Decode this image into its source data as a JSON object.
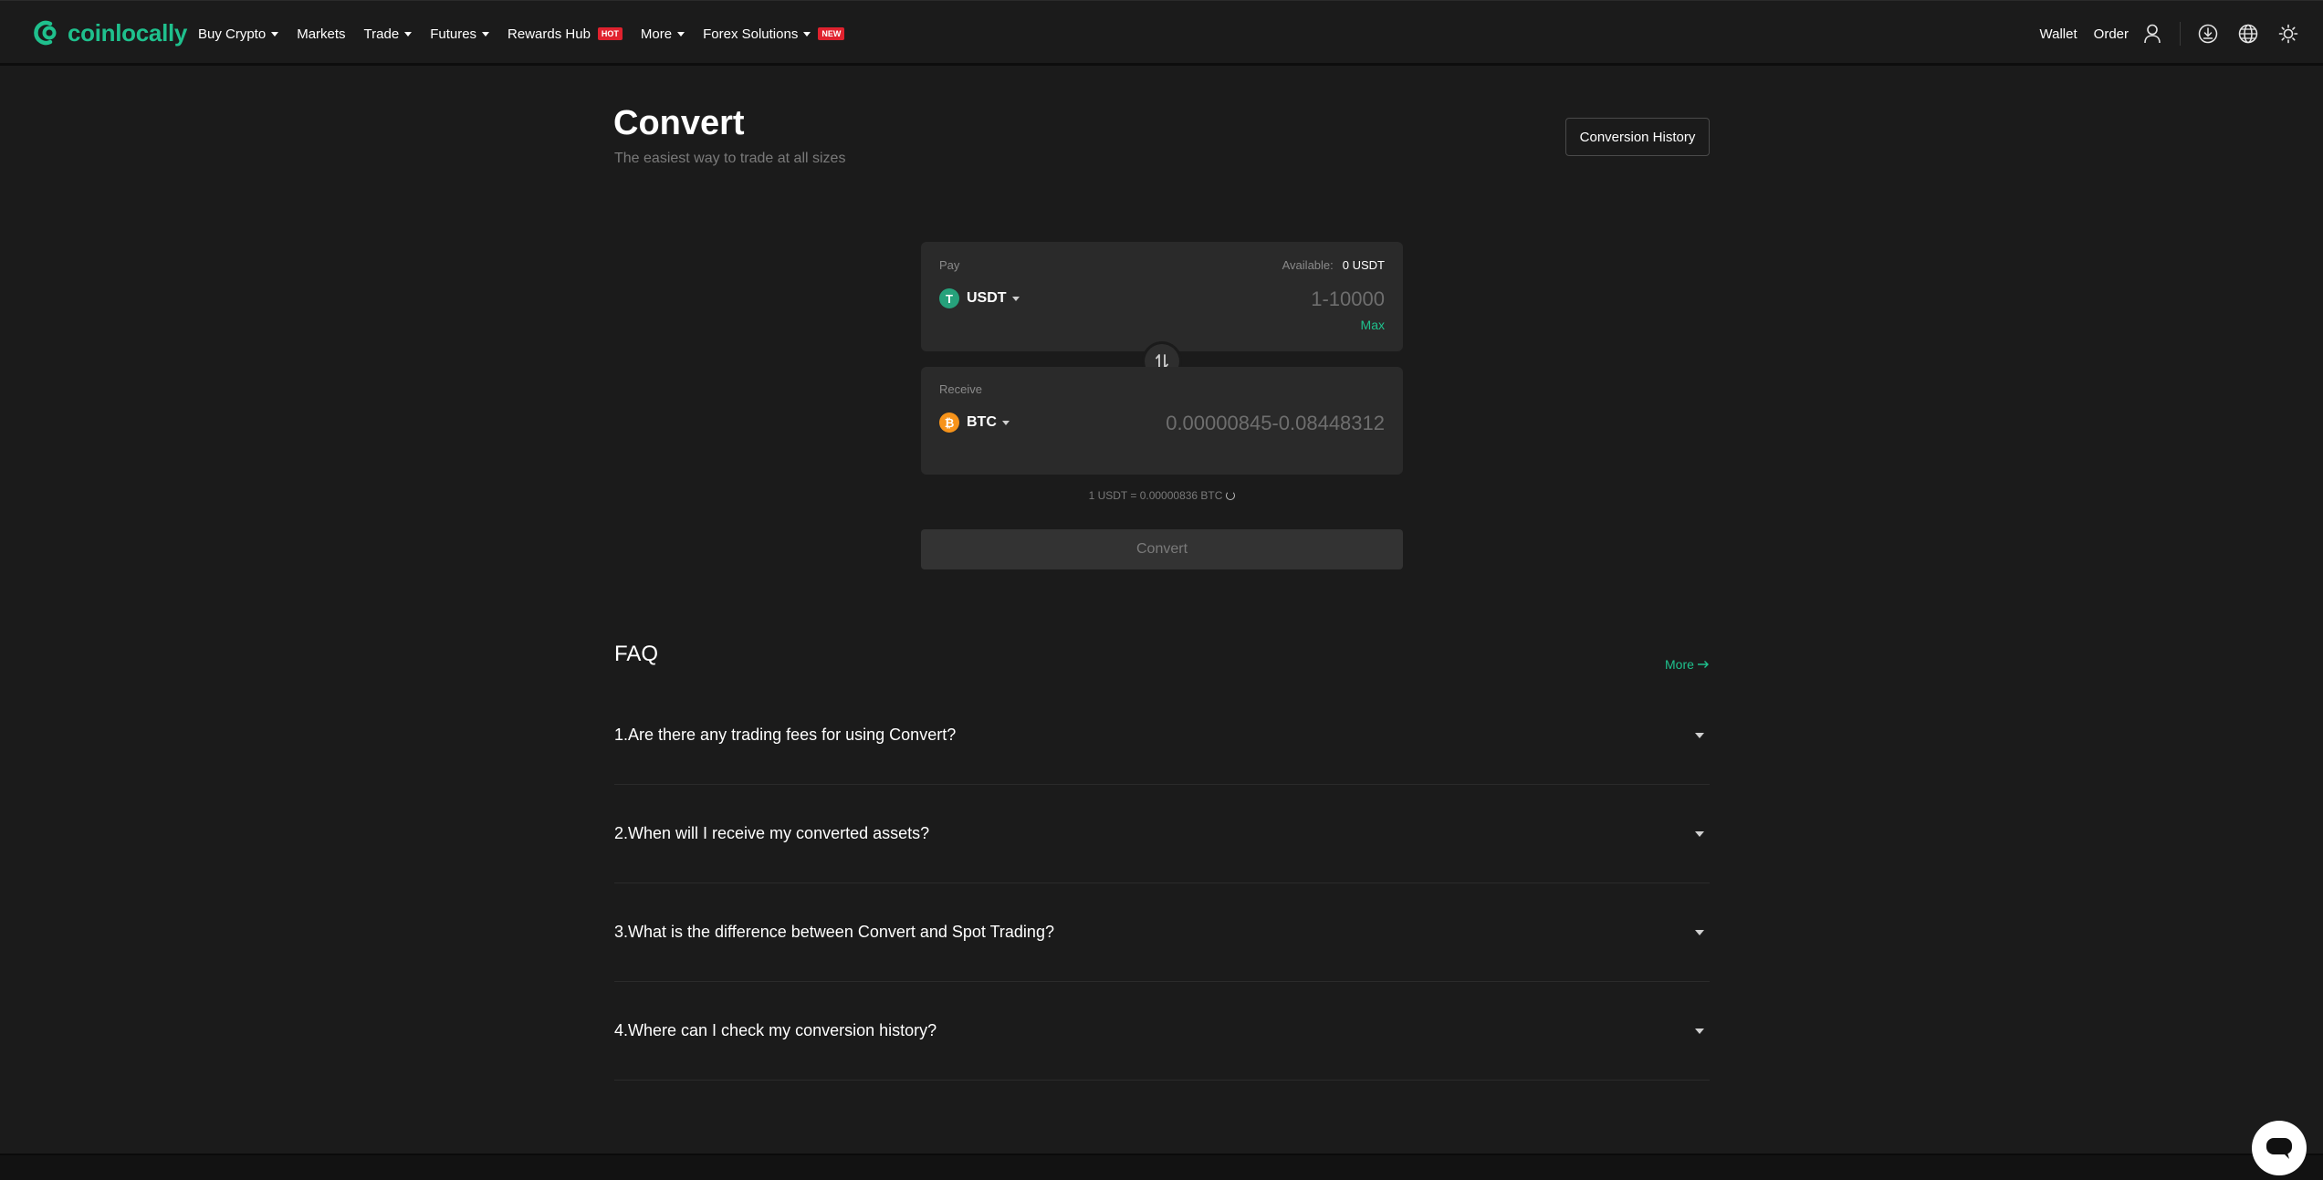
{
  "brand": {
    "name": "coinlocally",
    "accent": "#1fc08d"
  },
  "nav": {
    "items": [
      {
        "label": "Buy Crypto",
        "dropdown": true
      },
      {
        "label": "Markets",
        "dropdown": false
      },
      {
        "label": "Trade",
        "dropdown": true
      },
      {
        "label": "Futures",
        "dropdown": true
      },
      {
        "label": "Rewards Hub",
        "dropdown": false,
        "tag": "HOT"
      },
      {
        "label": "More",
        "dropdown": true
      },
      {
        "label": "Forex Solutions",
        "dropdown": true,
        "tag": "NEW"
      }
    ],
    "right": {
      "wallet": "Wallet",
      "order": "Order"
    }
  },
  "header": {
    "title": "Convert",
    "subtitle": "The easiest way to trade at all sizes",
    "history_button": "Conversion History"
  },
  "pay": {
    "label": "Pay",
    "available_label": "Available:",
    "available_value": "0 USDT",
    "coin": "USDT",
    "coin_symbol": "T",
    "coin_color": "#26a17b",
    "amount_placeholder": "1-10000",
    "max_label": "Max"
  },
  "receive": {
    "label": "Receive",
    "coin": "BTC",
    "coin_symbol": "₿",
    "coin_color": "#f7931a",
    "amount_placeholder": "0.00000845-0.08448312"
  },
  "rate": "1 USDT = 0.00000836 BTC",
  "convert_button": "Convert",
  "faq": {
    "title": "FAQ",
    "more": "More",
    "items": [
      "1.Are there any trading fees for using Convert?",
      "2.When will I receive my converted assets?",
      "3.What is the difference between Convert and Spot Trading?",
      "4.Where can I check my conversion history?"
    ]
  }
}
